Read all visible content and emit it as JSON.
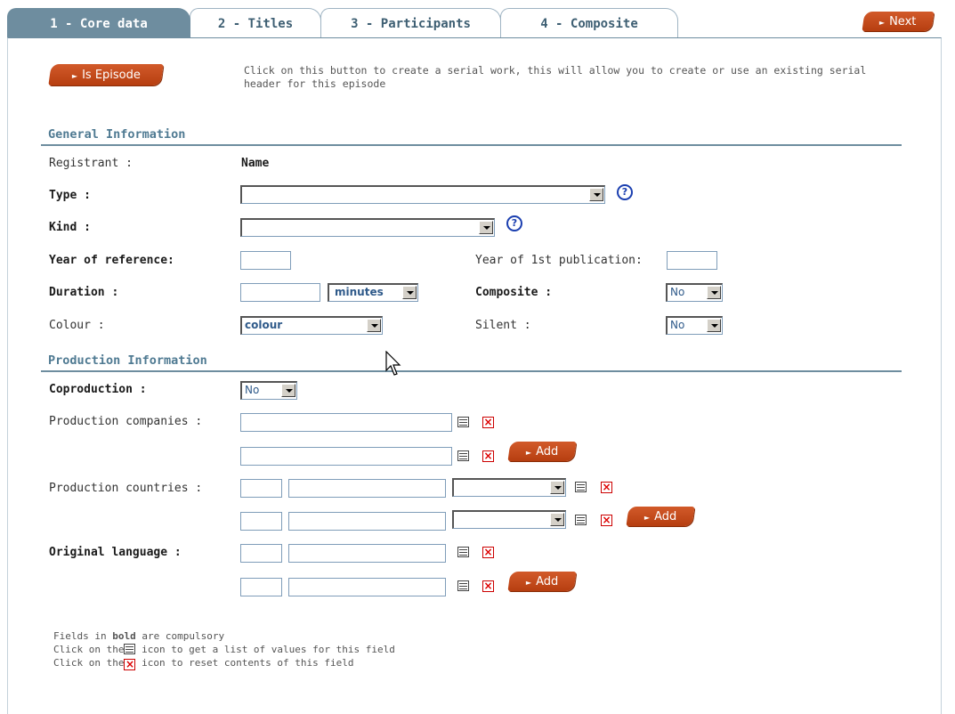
{
  "tabs": [
    {
      "label": "1 - Core data"
    },
    {
      "label": "2 - Titles"
    },
    {
      "label": "3 - Participants"
    },
    {
      "label": "4 - Composite"
    }
  ],
  "next_button": "Next",
  "episode": {
    "button": "Is Episode",
    "hint": "Click on this button to create a serial work, this will allow you to create or use an existing serial header for this episode"
  },
  "general": {
    "title": "General Information",
    "registrant_label": "Registrant :",
    "registrant_value": "Name",
    "type_label": "Type :",
    "type_value": "",
    "kind_label": "Kind :",
    "kind_value": "",
    "year_ref_label": "Year of reference:",
    "year_ref_value": "",
    "year_first_label": "Year of 1st publication:",
    "year_first_value": "",
    "duration_label": "Duration :",
    "duration_value": "",
    "duration_unit": "minutes",
    "composite_label": "Composite :",
    "composite_value": "No",
    "colour_label": "Colour :",
    "colour_value": "colour",
    "silent_label": "Silent :",
    "silent_value": "No"
  },
  "production": {
    "title": "Production Information",
    "coproduction_label": "Coproduction :",
    "coproduction_value": "No",
    "companies_label": "Production companies :",
    "countries_label": "Production countries :",
    "language_label": "Original language :",
    "add_label": "Add"
  },
  "footer": {
    "line1_pre": "Fields in ",
    "line1_bold": "bold",
    "line1_post": " are compulsory",
    "line2_pre": "Click on the",
    "line2_post": " icon to get a list of values for this field",
    "line3_pre": "Click on the",
    "line3_post": " icon to reset contents of this field"
  },
  "icons": {
    "help": "?",
    "reset": "×",
    "arrow": "►"
  },
  "colors": {
    "accent": "#6e8d9f",
    "button": "#c44a1a",
    "section_title": "#4f7a92",
    "help_icon": "#1b3fb0"
  }
}
